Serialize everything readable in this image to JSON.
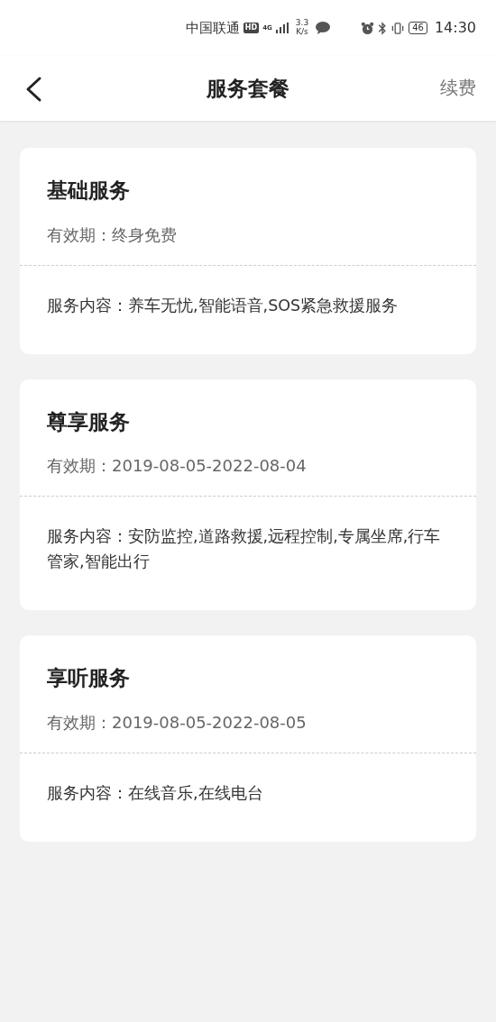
{
  "status_bar": {
    "carrier": "中国联通",
    "hd": "HD",
    "network": "4G",
    "speed_value": "3.3",
    "speed_unit": "K/s",
    "battery": "46",
    "time": "14:30"
  },
  "header": {
    "title": "服务套餐",
    "action": "续费"
  },
  "packages": [
    {
      "name": "基础服务",
      "validity_label": "有效期：",
      "validity": "终身免费",
      "content_label": "服务内容：",
      "content": "养车无忧,智能语音,SOS紧急救援服务"
    },
    {
      "name": "尊享服务",
      "validity_label": "有效期：",
      "validity": "2019-08-05-2022-08-04",
      "content_label": "服务内容：",
      "content": "安防监控,道路救援,远程控制,专属坐席,行车管家,智能出行"
    },
    {
      "name": "享听服务",
      "validity_label": "有效期：",
      "validity": "2019-08-05-2022-08-05",
      "content_label": "服务内容：",
      "content": "在线音乐,在线电台"
    }
  ]
}
